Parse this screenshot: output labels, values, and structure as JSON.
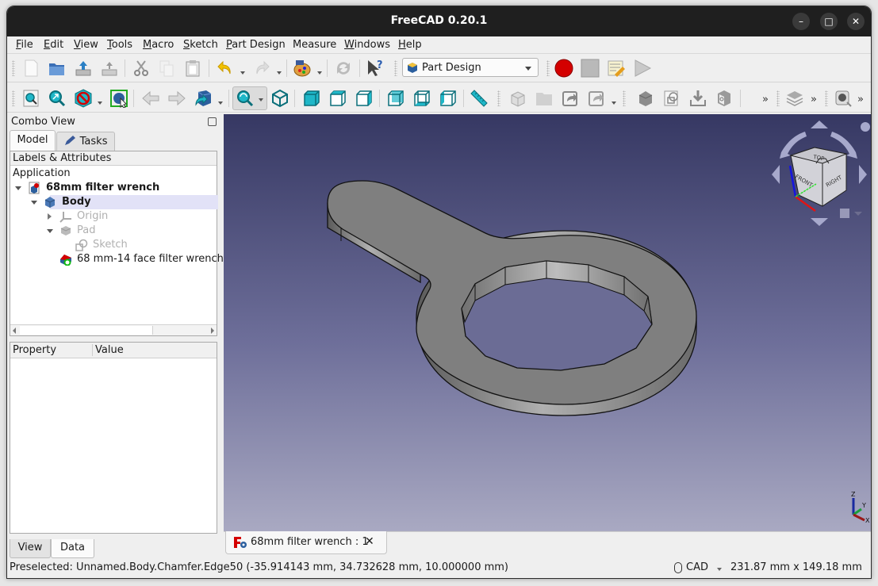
{
  "window": {
    "title": "FreeCAD 0.20.1",
    "controls": {
      "minimize": "–",
      "maximize": "□",
      "close": "✕"
    }
  },
  "menubar": {
    "items": [
      {
        "label": "File",
        "mnemonic": "F",
        "rest": "ile"
      },
      {
        "label": "Edit",
        "mnemonic": "E",
        "rest": "dit"
      },
      {
        "label": "View",
        "mnemonic": "V",
        "rest": "iew"
      },
      {
        "label": "Tools",
        "mnemonic": "T",
        "rest": "ools"
      },
      {
        "label": "Macro",
        "mnemonic": "M",
        "rest": "acro"
      },
      {
        "label": "Sketch",
        "mnemonic": "S",
        "rest": "ketch"
      },
      {
        "label": "Part Design",
        "mnemonic": "P",
        "rest": "art Design"
      },
      {
        "label": "Measure",
        "mnemonic": "",
        "rest": "Measure"
      },
      {
        "label": "Windows",
        "mnemonic": "W",
        "rest": "indows"
      },
      {
        "label": "Help",
        "mnemonic": "H",
        "rest": "elp"
      }
    ]
  },
  "toolbar1": {
    "icons": [
      "new-file-icon",
      "open-file-icon",
      "save-icon",
      "save-as-icon",
      "cut-icon",
      "copy-icon",
      "paste-icon",
      "undo-icon",
      "redo-icon",
      "workbench-palette-icon",
      "refresh-icon",
      "whats-this-icon"
    ],
    "workbench_selector": "Part Design",
    "macro_icons": [
      "record-macro-icon",
      "stop-macro-icon",
      "edit-macro-icon",
      "execute-macro-icon"
    ]
  },
  "toolbar2": {
    "overflow_glyph": "»"
  },
  "combo_view": {
    "title": "Combo View",
    "tabs": {
      "model": "Model",
      "tasks": "Tasks"
    },
    "tree_header": "Labels & Attributes",
    "tree": [
      {
        "label": "Application",
        "level": 0,
        "bold": false,
        "dim": false
      },
      {
        "label": "68mm filter wrench",
        "level": 1,
        "bold": true,
        "dim": false,
        "expanded": true
      },
      {
        "label": "Body",
        "level": 2,
        "bold": true,
        "dim": false,
        "expanded": true,
        "selected": true
      },
      {
        "label": "Origin",
        "level": 3,
        "bold": false,
        "dim": true,
        "expanded": false
      },
      {
        "label": "Pad",
        "level": 3,
        "bold": false,
        "dim": true,
        "expanded": true
      },
      {
        "label": "Sketch",
        "level": 4,
        "bold": false,
        "dim": true
      },
      {
        "label": "68 mm-14 face filter wrench",
        "level": 3,
        "bold": false,
        "dim": false
      }
    ],
    "property_columns": {
      "property": "Property",
      "value": "Value"
    },
    "bottom_tabs": {
      "view": "View",
      "data": "Data"
    }
  },
  "navcube": {
    "faces": {
      "top": "TOP",
      "front": "FRONT",
      "right": "RIGHT"
    }
  },
  "axis": {
    "x": "X",
    "y": "Y",
    "z": "Z"
  },
  "document_tab": {
    "label": "68mm filter wrench : 1",
    "close": "✕"
  },
  "statusbar": {
    "message": "Preselected: Unnamed.Body.Chamfer.Edge50 (-35.914143 mm, 34.732628 mm, 10.000000 mm)",
    "nav_style": "CAD",
    "dimensions": "231.87 mm x 149.18 mm"
  },
  "colors": {
    "accent_teal": "#1fb7c8",
    "record_red": "#d40000",
    "selection": "#e2e2f7",
    "viewport_top": "#363863",
    "viewport_bottom": "#a9a9c2"
  }
}
